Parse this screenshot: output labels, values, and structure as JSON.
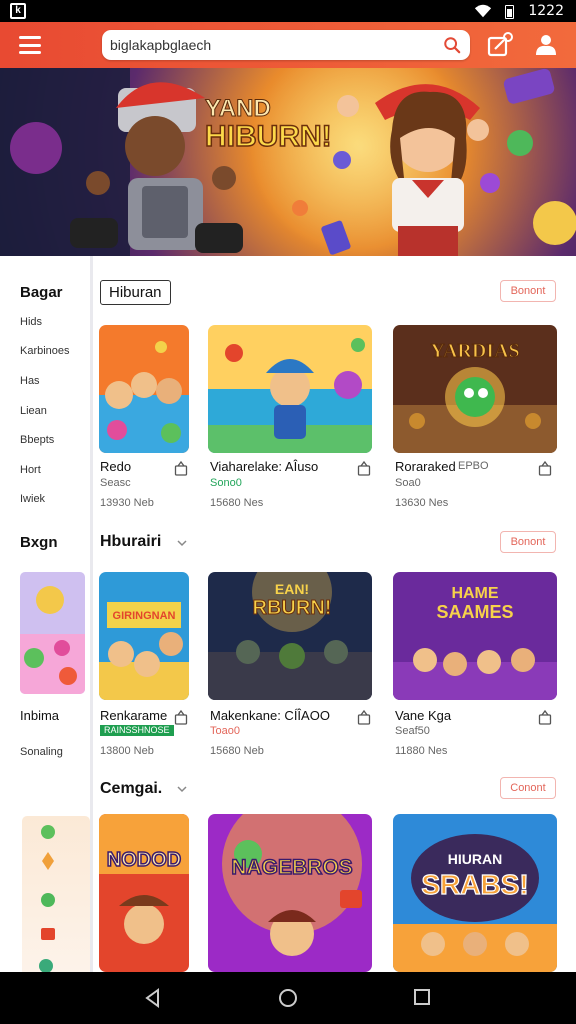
{
  "status_bar": {
    "time": "1222",
    "app_icon": "k"
  },
  "search": {
    "value": "biglakapbglaech"
  },
  "banner": {
    "headline_1": "YAND",
    "headline_2": "HIBURN!"
  },
  "sidebar": {
    "heading_1": "Bagar",
    "items": [
      "Hids",
      "Karbinoes",
      "Has",
      "Liean",
      "Bbepts",
      "Hort",
      "Iwiek"
    ],
    "heading_2": "Bxgn",
    "label_1": "Inbima",
    "label_2": "Sonaling"
  },
  "sections": [
    {
      "title": "Hiburan",
      "action": "Bonont",
      "cards": [
        {
          "title": "Redo",
          "sub": "Seasc",
          "meta": "13930 Neb"
        },
        {
          "title": "Viaharelake: AÎuso",
          "sub": "Sono0",
          "meta": "15680 Nes"
        },
        {
          "title": "Roraraked",
          "title_extra": "EPBO",
          "sub": "Soa0",
          "meta": "13630 Nes"
        }
      ]
    },
    {
      "title": "Hburairi",
      "action": "Bonont",
      "cards": [
        {
          "title": "Renkarame",
          "badge": "RAINSSHNOSE",
          "meta": "13800 Neb"
        },
        {
          "title": "Makenkane: CÍÎAOO",
          "sub": "Toao0",
          "meta": "15680 Neb"
        },
        {
          "title": "Vane Kga",
          "sub": "Seaf50",
          "meta": "11880 Nes"
        }
      ]
    },
    {
      "title": "Cemgai.",
      "action": "Conont",
      "cards": [
        {
          "art_text": "NODOD"
        },
        {
          "art_text": "NAGEBROS"
        },
        {
          "art_text_1": "HIURAN",
          "art_text_2": "SRABS!"
        }
      ]
    }
  ],
  "card_art_text": {
    "s1c3": "YARDIAS",
    "s2c1": "GIRINGNAN",
    "s2c2_1": "EAN!",
    "s2c2_2": "RBURN!",
    "s2c3_1": "HAME",
    "s2c3_2": "SAAMES"
  },
  "colors": {
    "topbar": "#e84a32",
    "accent": "#e3665a",
    "green": "#22a55a"
  }
}
